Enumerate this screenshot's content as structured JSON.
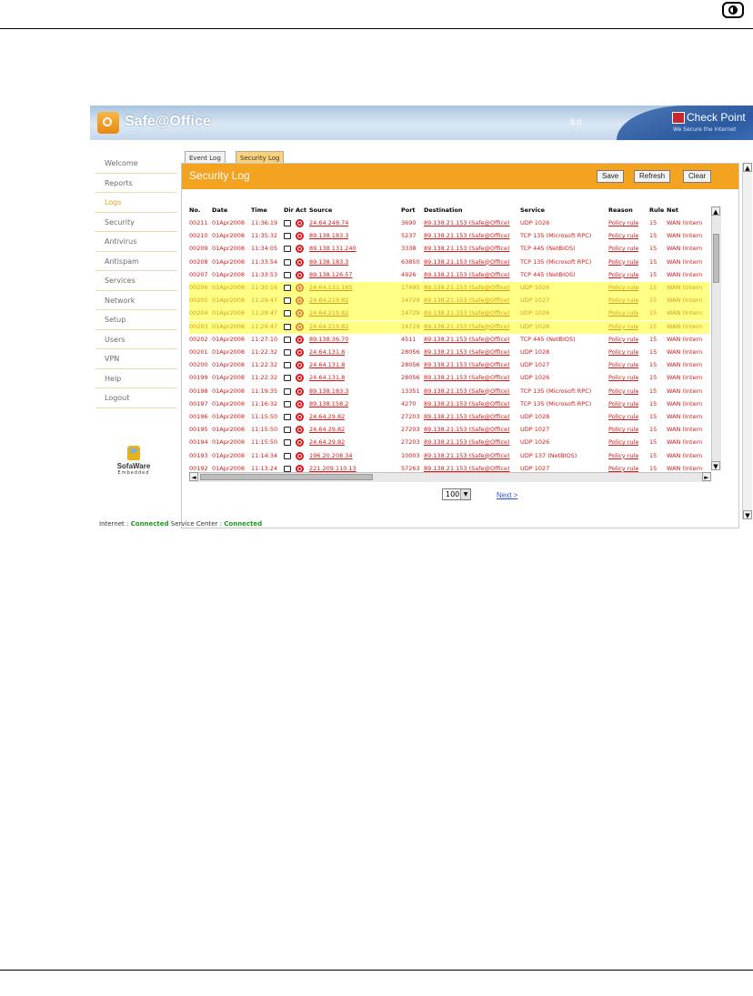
{
  "app": {
    "title": "Safe@Office",
    "version": "8.0",
    "vendor": "Check Point",
    "vendor_tagline": "We Secure the Internet"
  },
  "sidebar": {
    "items": [
      {
        "label": "Welcome",
        "active": false
      },
      {
        "label": "Reports",
        "active": false
      },
      {
        "label": "Logs",
        "active": true
      },
      {
        "label": "Security",
        "active": false
      },
      {
        "label": "Antivirus",
        "active": false
      },
      {
        "label": "Antispam",
        "active": false
      },
      {
        "label": "Services",
        "active": false
      },
      {
        "label": "Network",
        "active": false
      },
      {
        "label": "Setup",
        "active": false
      },
      {
        "label": "Users",
        "active": false
      },
      {
        "label": "VPN",
        "active": false
      },
      {
        "label": "Help",
        "active": false
      },
      {
        "label": "Logout",
        "active": false
      }
    ],
    "brand_name": "SofaWare",
    "brand_sub": "Embedded"
  },
  "tabs": [
    {
      "label": "Event Log",
      "active": false
    },
    {
      "label": "Security Log",
      "active": true
    }
  ],
  "page_title": "Security Log",
  "toolbar": {
    "save": "Save",
    "refresh": "Refresh",
    "clear": "Clear"
  },
  "table": {
    "columns": [
      "No.",
      "Date",
      "Time",
      "Dir",
      "Act",
      "Source",
      "Port",
      "Destination",
      "Service",
      "Reason",
      "Rule",
      "Net"
    ],
    "rows": [
      {
        "no": "00211",
        "date": "01Apr2008",
        "time": "11:36:19",
        "source": "24.64.248.74",
        "port": "3690",
        "destination": "89.138.21.153 (Safe@Office)",
        "service": "UDP 1026",
        "reason": "Policy rule",
        "rule": "15",
        "net": "WAN (Intern",
        "hl": false
      },
      {
        "no": "00210",
        "date": "01Apr2008",
        "time": "11:35:32",
        "source": "89.138.183.3",
        "port": "5237",
        "destination": "89.138.21.153 (Safe@Office)",
        "service": "TCP 135 (Microsoft RPC)",
        "reason": "Policy rule",
        "rule": "15",
        "net": "WAN (Intern",
        "hl": false
      },
      {
        "no": "00209",
        "date": "01Apr2008",
        "time": "11:34:05",
        "source": "89.138.131.240",
        "port": "3338",
        "destination": "89.138.21.153 (Safe@Office)",
        "service": "TCP 445 (NetBIOS)",
        "reason": "Policy rule",
        "rule": "15",
        "net": "WAN (Intern",
        "hl": false
      },
      {
        "no": "00208",
        "date": "01Apr2008",
        "time": "11:33:54",
        "source": "89.138.183.3",
        "port": "63850",
        "destination": "89.138.21.153 (Safe@Office)",
        "service": "TCP 135 (Microsoft RPC)",
        "reason": "Policy rule",
        "rule": "15",
        "net": "WAN (Intern",
        "hl": false
      },
      {
        "no": "00207",
        "date": "01Apr2008",
        "time": "11:33:53",
        "source": "89.138.126.57",
        "port": "4926",
        "destination": "89.138.21.153 (Safe@Office)",
        "service": "TCP 445 (NetBIOS)",
        "reason": "Policy rule",
        "rule": "15",
        "net": "WAN (Intern",
        "hl": false
      },
      {
        "no": "00206",
        "date": "01Apr2008",
        "time": "11:30:16",
        "source": "24.64.131.185",
        "port": "17495",
        "destination": "89.138.21.153 (Safe@Office)",
        "service": "UDP 1026",
        "reason": "Policy rule",
        "rule": "15",
        "net": "WAN (Intern",
        "hl": true
      },
      {
        "no": "00205",
        "date": "01Apr2008",
        "time": "11:29:47",
        "source": "24.64.219.82",
        "port": "14729",
        "destination": "89.138.21.153 (Safe@Office)",
        "service": "UDP 1027",
        "reason": "Policy rule",
        "rule": "15",
        "net": "WAN (Intern",
        "hl": true
      },
      {
        "no": "00204",
        "date": "01Apr2008",
        "time": "11:29:47",
        "source": "24.64.219.82",
        "port": "14729",
        "destination": "89.138.21.153 (Safe@Office)",
        "service": "UDP 1026",
        "reason": "Policy rule",
        "rule": "15",
        "net": "WAN (Intern",
        "hl": true
      },
      {
        "no": "00203",
        "date": "01Apr2008",
        "time": "11:29:47",
        "source": "24.64.219.82",
        "port": "14729",
        "destination": "89.138.21.153 (Safe@Office)",
        "service": "UDP 1028",
        "reason": "Policy rule",
        "rule": "15",
        "net": "WAN (Intern",
        "hl": true
      },
      {
        "no": "00202",
        "date": "01Apr2008",
        "time": "11:27:10",
        "source": "89.138.36.70",
        "port": "4511",
        "destination": "89.138.21.153 (Safe@Office)",
        "service": "TCP 445 (NetBIOS)",
        "reason": "Policy rule",
        "rule": "15",
        "net": "WAN (Intern",
        "hl": false
      },
      {
        "no": "00201",
        "date": "01Apr2008",
        "time": "11:22:32",
        "source": "24.64.131.8",
        "port": "28056",
        "destination": "89.138.21.153 (Safe@Office)",
        "service": "UDP 1028",
        "reason": "Policy rule",
        "rule": "15",
        "net": "WAN (Intern",
        "hl": false
      },
      {
        "no": "00200",
        "date": "01Apr2008",
        "time": "11:22:32",
        "source": "24.64.131.8",
        "port": "28056",
        "destination": "89.138.21.153 (Safe@Office)",
        "service": "UDP 1027",
        "reason": "Policy rule",
        "rule": "15",
        "net": "WAN (Intern",
        "hl": false
      },
      {
        "no": "00199",
        "date": "01Apr2008",
        "time": "11:22:32",
        "source": "24.64.131.8",
        "port": "28056",
        "destination": "89.138.21.153 (Safe@Office)",
        "service": "UDP 1026",
        "reason": "Policy rule",
        "rule": "15",
        "net": "WAN (Intern",
        "hl": false
      },
      {
        "no": "00198",
        "date": "01Apr2008",
        "time": "11:19:35",
        "source": "89.138.183.3",
        "port": "13351",
        "destination": "89.138.21.153 (Safe@Office)",
        "service": "TCP 135 (Microsoft RPC)",
        "reason": "Policy rule",
        "rule": "15",
        "net": "WAN (Intern",
        "hl": false
      },
      {
        "no": "00197",
        "date": "01Apr2008",
        "time": "11:16:32",
        "source": "89.138.158.2",
        "port": "4270",
        "destination": "89.138.21.153 (Safe@Office)",
        "service": "TCP 135 (Microsoft RPC)",
        "reason": "Policy rule",
        "rule": "15",
        "net": "WAN (Intern",
        "hl": false
      },
      {
        "no": "00196",
        "date": "01Apr2008",
        "time": "11:15:50",
        "source": "24.64.29.82",
        "port": "27203",
        "destination": "89.138.21.153 (Safe@Office)",
        "service": "UDP 1028",
        "reason": "Policy rule",
        "rule": "15",
        "net": "WAN (Intern",
        "hl": false
      },
      {
        "no": "00195",
        "date": "01Apr2008",
        "time": "11:15:50",
        "source": "24.64.29.82",
        "port": "27203",
        "destination": "89.138.21.153 (Safe@Office)",
        "service": "UDP 1027",
        "reason": "Policy rule",
        "rule": "15",
        "net": "WAN (Intern",
        "hl": false
      },
      {
        "no": "00194",
        "date": "01Apr2008",
        "time": "11:15:50",
        "source": "24.64.29.82",
        "port": "27203",
        "destination": "89.138.21.153 (Safe@Office)",
        "service": "UDP 1026",
        "reason": "Policy rule",
        "rule": "15",
        "net": "WAN (Intern",
        "hl": false
      },
      {
        "no": "00193",
        "date": "01Apr2008",
        "time": "11:14:34",
        "source": "196.20.208.34",
        "port": "10003",
        "destination": "89.138.21.153 (Safe@Office)",
        "service": "UDP 137 (NetBIOS)",
        "reason": "Policy rule",
        "rule": "15",
        "net": "WAN (Intern",
        "hl": false
      },
      {
        "no": "00192",
        "date": "01Apr2008",
        "time": "11:13:24",
        "source": "221.209.110.13",
        "port": "57263",
        "destination": "89.138.21.153 (Safe@Office)",
        "service": "UDP 1027",
        "reason": "Policy rule",
        "rule": "15",
        "net": "WAN (Intern",
        "hl": false
      }
    ]
  },
  "pager": {
    "page_size": "100",
    "next_label": "Next >"
  },
  "status": {
    "internet_label": "Internet :",
    "internet_value": "Connected",
    "service_label": "Service Center :",
    "service_value": "Connected"
  },
  "colors": {
    "accent": "#f4a321",
    "row_text": "#d61a1a",
    "highlight_row": "#ffff85",
    "connected": "#1a9a1a"
  }
}
